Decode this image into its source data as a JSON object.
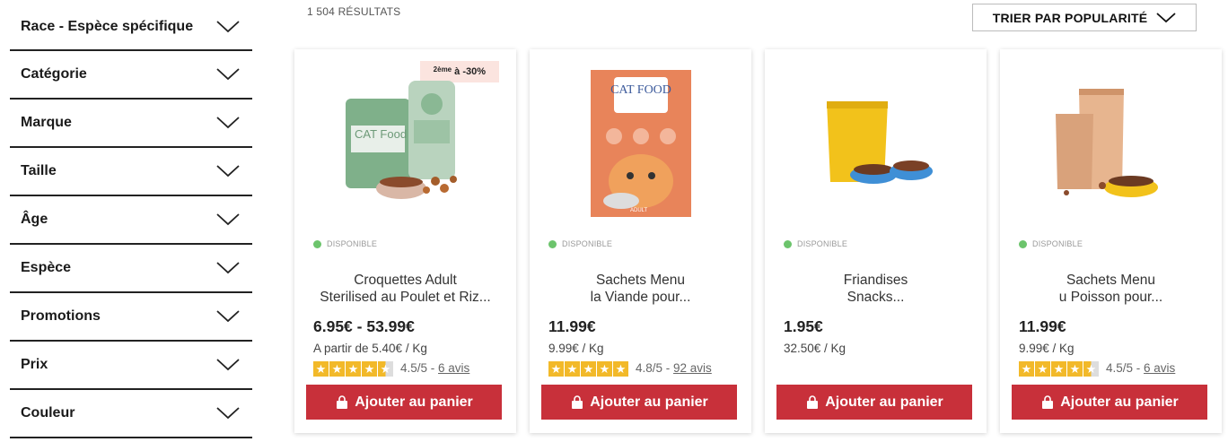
{
  "filters": [
    {
      "label": "Race - Espèce spécifique"
    },
    {
      "label": "Catégorie"
    },
    {
      "label": "Marque"
    },
    {
      "label": "Taille"
    },
    {
      "label": "Âge"
    },
    {
      "label": "Espèce"
    },
    {
      "label": "Promotions"
    },
    {
      "label": "Prix"
    },
    {
      "label": "Couleur"
    }
  ],
  "results_count": "1 504 RÉSULTATS",
  "sort": {
    "label": "TRIER PAR POPULARITÉ"
  },
  "products": [
    {
      "promo": {
        "sup": "2ème",
        "text": "à -30%"
      },
      "availability": "DISPONIBLE",
      "name_line1": "Croquettes Adult",
      "name_line2": "Sterilised au Poulet et Riz...",
      "price": "6.95€ - 53.99€",
      "unit_price": "A partir de 5.40€ / Kg",
      "rating": "4.5/5 - ",
      "reviews": "6 avis",
      "cart_label": "Ajouter au panier",
      "image_text": "CAT Food"
    },
    {
      "availability": "DISPONIBLE",
      "name_line1": "Sachets Menu",
      "name_line2": "la Viande pour...",
      "price": "11.99€",
      "unit_price": "9.99€ / Kg",
      "rating": "4.8/5 - ",
      "reviews": "92 avis",
      "cart_label": "Ajouter au panier",
      "image_text": "CAT FOOD",
      "image_sub": "ADULT"
    },
    {
      "availability": "DISPONIBLE",
      "name_line1": "Friandises",
      "name_line2": "Snacks...",
      "price": "1.95€",
      "unit_price": "32.50€ / Kg",
      "cart_label": "Ajouter au panier"
    },
    {
      "availability": "DISPONIBLE",
      "name_line1": "Sachets Menu",
      "name_line2": "u Poisson pour...",
      "price": "11.99€",
      "unit_price": "9.99€ / Kg",
      "rating": "4.5/5 - ",
      "reviews": "6 avis",
      "cart_label": "Ajouter au panier"
    }
  ],
  "colors": {
    "accent": "#c8303a",
    "star": "#f2b929",
    "available": "#6cc46c",
    "promo_bg": "#fbe4df"
  },
  "icons": {
    "filter_toggle": "chevron-down-icon",
    "cart": "shopping-bag-icon"
  }
}
